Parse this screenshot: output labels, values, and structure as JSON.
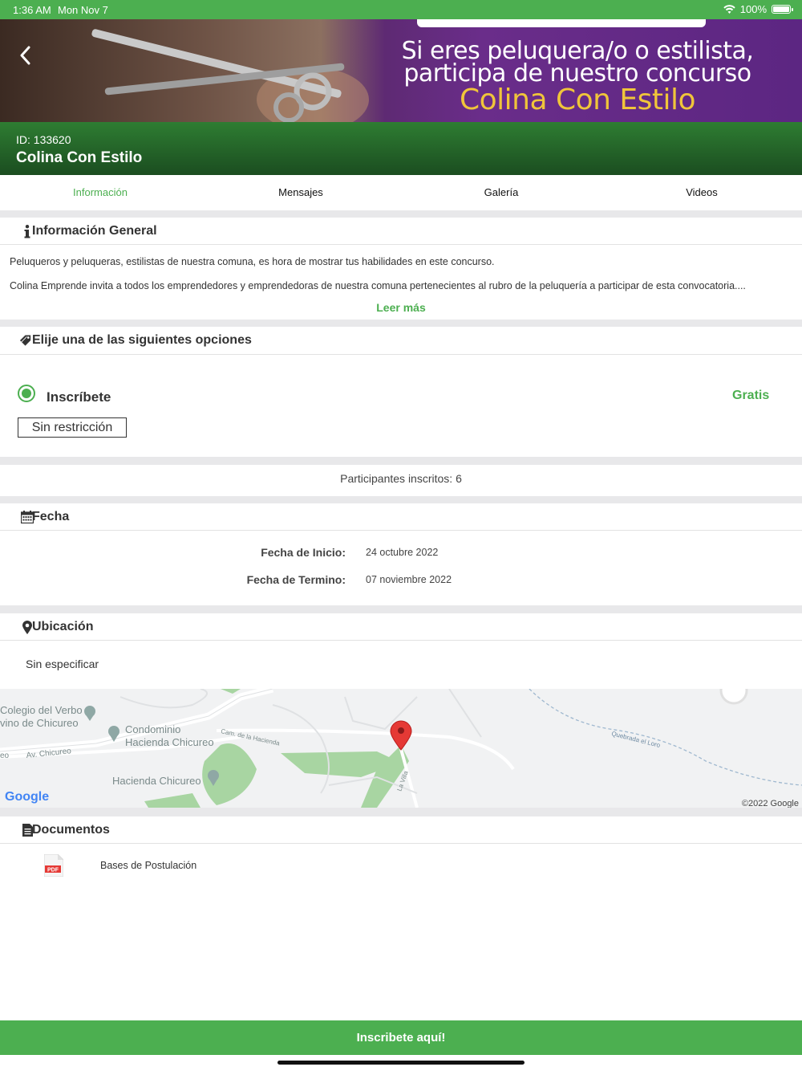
{
  "status_bar": {
    "time": "1:36 AM",
    "date": "Mon Nov 7",
    "battery": "100%"
  },
  "banner": {
    "headline_line1": "Si eres peluquera/o o estilista,",
    "headline_line2": "participa de nuestro concurso",
    "brand": "Colina Con Estilo"
  },
  "header": {
    "id_text": "ID: 133620",
    "title": "Colina Con Estilo"
  },
  "tabs": [
    {
      "label": "Información"
    },
    {
      "label": "Mensajes"
    },
    {
      "label": "Galería"
    },
    {
      "label": "Videos"
    }
  ],
  "info_general": {
    "title": "Información General",
    "paragraph1": "Peluqueros y peluqueras, estilistas de nuestra comuna, es hora de mostrar tus habilidades en este concurso.",
    "paragraph2": "Colina Emprende invita a todos los emprendedores y emprendedoras de nuestra comuna pertenecientes al rubro de la peluquería a participar de esta convocatoria....",
    "read_more": "Leer más"
  },
  "options": {
    "title": "Elije una de las siguientes opciones",
    "option_label": "Inscríbete",
    "price": "Gratis",
    "restriction": "Sin restricción"
  },
  "participants": "Participantes inscritos: 6",
  "dates": {
    "title": "Fecha",
    "start_label": "Fecha de Inicio:",
    "start_value": "24 octubre 2022",
    "end_label": "Fecha de Termino:",
    "end_value": "07 noviembre 2022"
  },
  "location": {
    "title": "Ubicación",
    "value": "Sin especificar",
    "map_labels": {
      "colegio1": "Colegio del Verbo",
      "colegio2": "vino de Chicureo",
      "condominio1": "Condominio",
      "condominio2": "Hacienda Chicureo",
      "camino": "Cam. de la Hacienda",
      "avenida": "Av. Chicureo",
      "avenida_left": "eo",
      "hacienda": "Hacienda Chicureo",
      "quebrada": "Quebrada el Loro",
      "la_villa": "La Villa",
      "google": "Google",
      "copyright": "©2022 Google"
    }
  },
  "documents": {
    "title": "Documentos",
    "items": [
      {
        "name": "Bases de Postulación",
        "badge": "PDF"
      }
    ]
  },
  "cta": {
    "label": "Inscribete aquí!"
  },
  "colors": {
    "accent": "#4caf50",
    "header_dark": "#1b4d20",
    "banner_purple": "#6a2d8a",
    "brand_gold": "#f0c53a"
  }
}
